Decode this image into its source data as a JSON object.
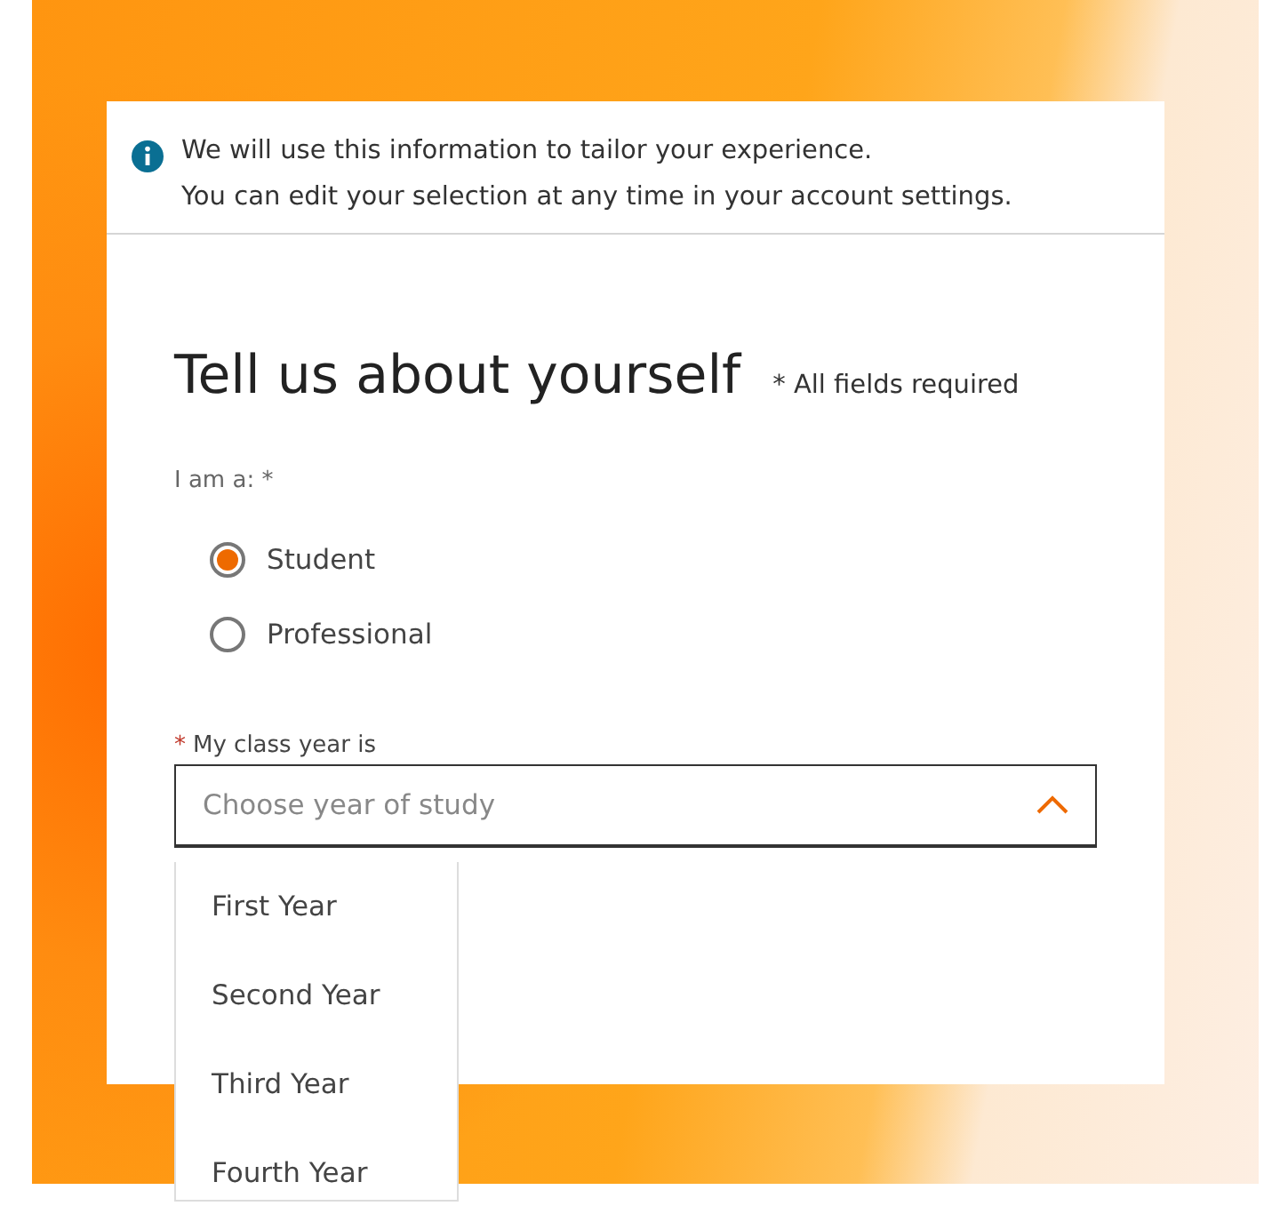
{
  "info": {
    "lines": [
      "We will use this information to tailor your experience.",
      "You can edit your selection at any time in your account settings."
    ]
  },
  "heading": "Tell us about yourself",
  "required_note": "* All fields required",
  "role_question": {
    "label": "I am a: *",
    "options": [
      {
        "label": "Student",
        "selected": true
      },
      {
        "label": "Professional",
        "selected": false
      }
    ]
  },
  "class_year": {
    "asterisk": "*",
    "label": "My class year is",
    "placeholder": "Choose year of study",
    "expanded": true,
    "options": [
      "First Year",
      "Second Year",
      "Third Year",
      "Fourth Year"
    ]
  }
}
